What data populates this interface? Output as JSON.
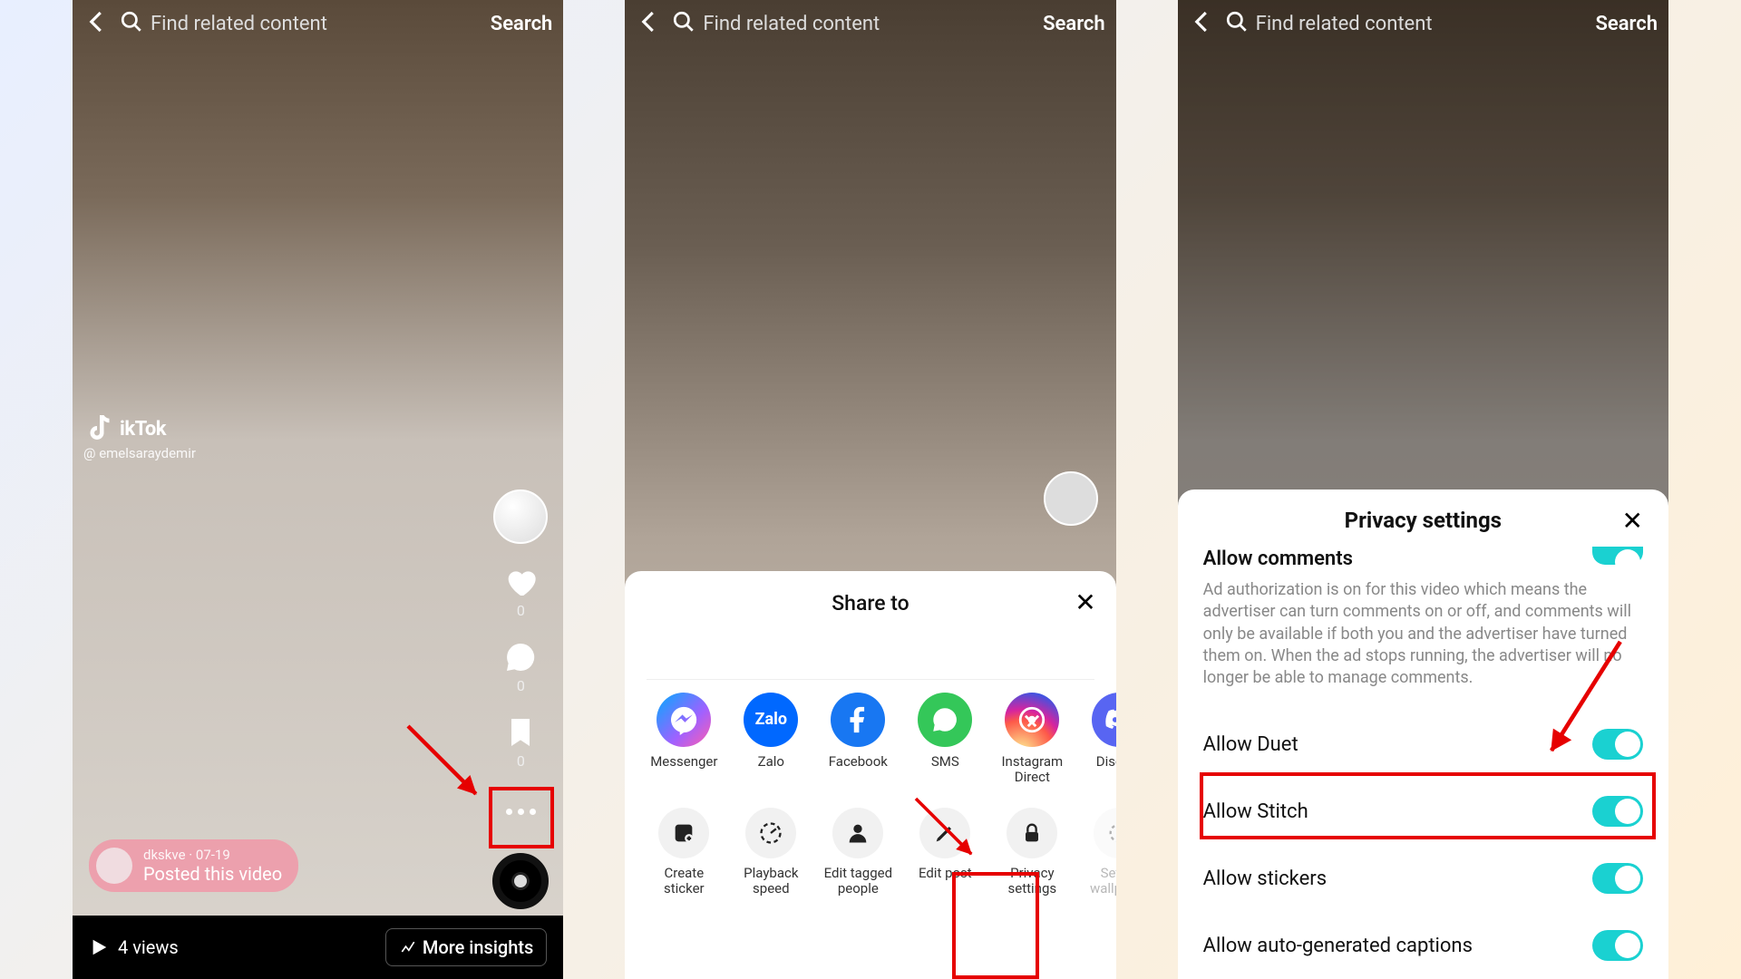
{
  "searchPlaceholder": "Find related content",
  "searchAction": "Search",
  "screen1": {
    "brand": "ikTok",
    "watermarkUser": "@ emelsaraydemir",
    "likeCount": "0",
    "commentCount": "0",
    "saveCount": "0",
    "postedUser": "dkskve",
    "postedDate": "07-19",
    "postedText": "Posted this video",
    "views": "4 views",
    "insightsBtn": "More insights"
  },
  "screen2": {
    "sheetTitle": "Share to",
    "shareTargets": [
      {
        "key": "messenger",
        "label": "Messenger"
      },
      {
        "key": "zalo",
        "label": "Zalo"
      },
      {
        "key": "facebook",
        "label": "Facebook"
      },
      {
        "key": "sms",
        "label": "SMS"
      },
      {
        "key": "instagram",
        "label": "Instagram Direct"
      },
      {
        "key": "discord",
        "label": "Discord"
      }
    ],
    "actions": [
      {
        "key": "create-sticker",
        "label": "Create sticker"
      },
      {
        "key": "playback-speed",
        "label": "Playback speed"
      },
      {
        "key": "edit-tagged",
        "label": "Edit tagged people"
      },
      {
        "key": "edit-post",
        "label": "Edit post"
      },
      {
        "key": "privacy",
        "label": "Privacy settings"
      },
      {
        "key": "wallpaper",
        "label": "Set as wallpaper"
      }
    ]
  },
  "screen3": {
    "sheetTitle": "Privacy settings",
    "partialRow": "Allow comments",
    "desc": "Ad authorization is on for this video which means the advertiser can turn comments on or off, and comments will only be available if both you and the advertiser have turned them on. When the ad stops running, the advertiser will no longer be able to manage comments.",
    "rows": [
      "Allow Duet",
      "Allow Stitch",
      "Allow stickers",
      "Allow auto-generated captions"
    ]
  }
}
